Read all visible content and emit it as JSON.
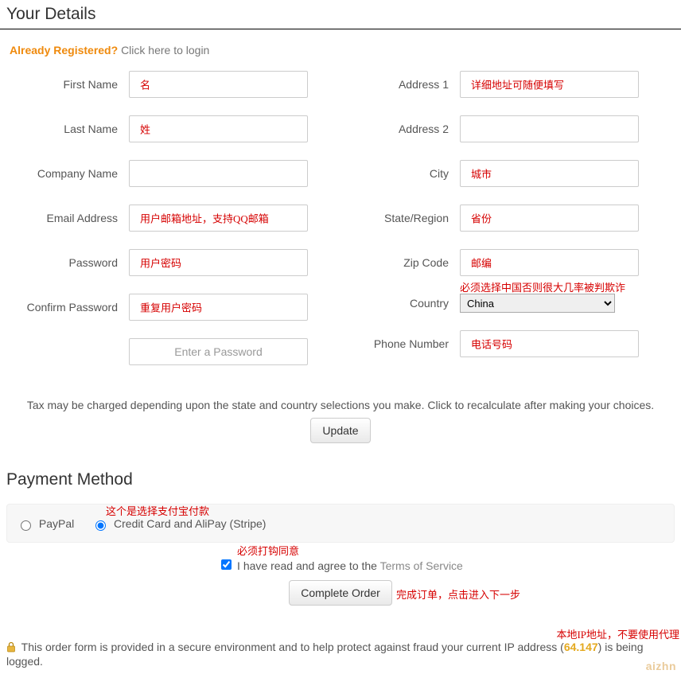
{
  "section1": {
    "title": "Your Details"
  },
  "login": {
    "question": "Already Registered?",
    "link": "Click here to login"
  },
  "left": {
    "first_name": {
      "label": "First Name",
      "annot": "名"
    },
    "last_name": {
      "label": "Last Name",
      "annot": "姓"
    },
    "company": {
      "label": "Company Name"
    },
    "email": {
      "label": "Email Address",
      "annot": "用户邮箱地址，支持QQ邮箱"
    },
    "password": {
      "label": "Password",
      "annot": "用户密码"
    },
    "confirm": {
      "label": "Confirm Password",
      "annot": "重复用户密码"
    },
    "enter_pw": {
      "placeholder": "Enter a Password"
    }
  },
  "right": {
    "addr1": {
      "label": "Address 1",
      "annot": "详细地址可随便填写"
    },
    "addr2": {
      "label": "Address 2"
    },
    "city": {
      "label": "City",
      "annot": "城市"
    },
    "state": {
      "label": "State/Region",
      "annot": "省份"
    },
    "zip": {
      "label": "Zip Code",
      "annot": "邮编"
    },
    "country": {
      "label": "Country",
      "value": "China",
      "annot": "必须选择中国否则很大几率被判欺诈"
    },
    "phone": {
      "label": "Phone Number",
      "annot": "电话号码"
    }
  },
  "tax": {
    "note": "Tax may be charged depending upon the state and country selections you make. Click to recalculate after making your choices.",
    "button": "Update"
  },
  "section2": {
    "title": "Payment Method"
  },
  "pm": {
    "paypal": "PayPal",
    "stripe": "Credit Card and AliPay (Stripe)",
    "annot": "这个是选择支付宝付款"
  },
  "tos": {
    "pre": "I have read and agree to the ",
    "link": "Terms of Service",
    "annot": "必须打钩同意"
  },
  "complete": {
    "button": "Complete Order",
    "annot": "完成订单，点击进入下一步"
  },
  "ip": {
    "top_annot": "本地IP地址，不要使用代理",
    "pre": "This order form is provided in a secure environment and to help protect against fraud your current IP address (",
    "ip_shown": "64.147",
    "post": ") is being logged.",
    "watermark": "aizhn"
  }
}
